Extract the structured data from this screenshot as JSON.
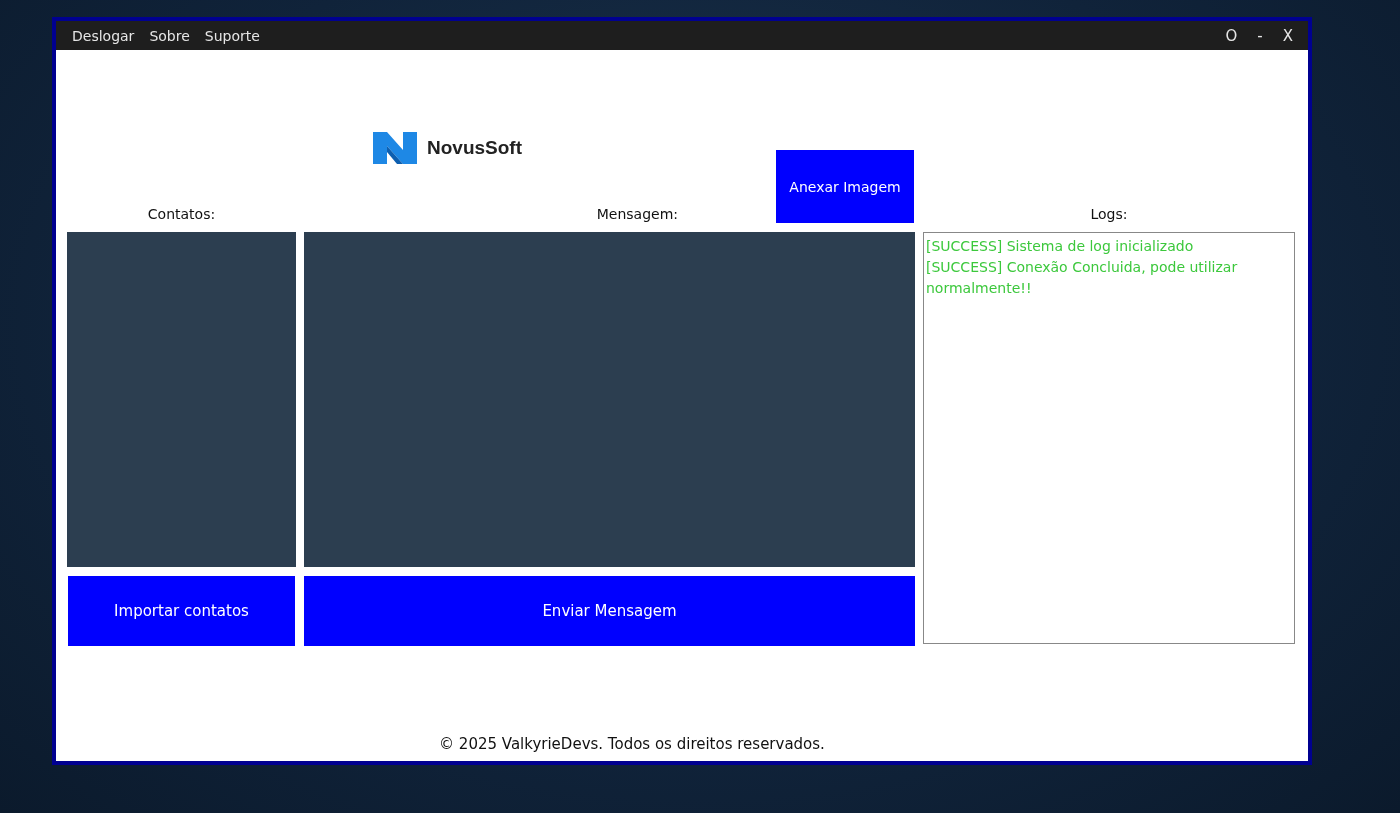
{
  "menu": [
    "Deslogar",
    "Sobre",
    "Suporte"
  ],
  "window_controls": [
    "O",
    "-",
    "X"
  ],
  "logo": {
    "text": "NovusSoft"
  },
  "contacts": {
    "label": "Contatos:",
    "button": "Importar contatos"
  },
  "message": {
    "label": "Mensagem:",
    "attach_button": "Anexar Imagem",
    "send_button": "Enviar Mensagem"
  },
  "logs": {
    "label": "Logs:",
    "entries": [
      {
        "kind": "success",
        "text": "[SUCCESS] Sistema de log inicializado"
      },
      {
        "kind": "success",
        "text": "[SUCCESS] Conexão Concluida, pode utilizar normalmente!!"
      }
    ]
  },
  "footer": "© 2025 ValkyrieDevs. Todos os direitos reservados."
}
